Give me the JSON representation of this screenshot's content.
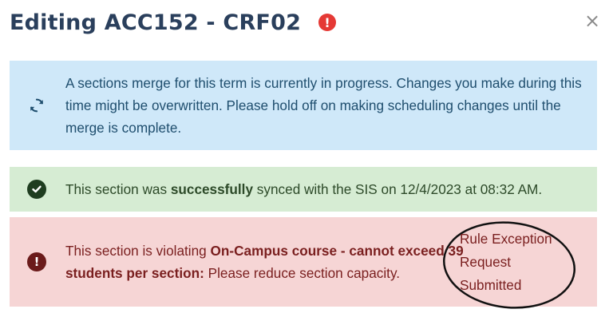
{
  "dialog": {
    "title": "Editing ACC152 - CRF02",
    "title_alert_glyph": "!",
    "close_glyph": "×"
  },
  "alerts": {
    "info": {
      "icon": "sync-icon",
      "message": "A sections merge for this term is currently in progress. Changes you make during this time might be overwritten. Please hold off on making scheduling changes until the merge is complete.",
      "color": "#cfe8f9"
    },
    "success": {
      "icon": "check-circle-icon",
      "text_before": "This section was ",
      "text_bold": "successfully",
      "text_after": " synced with the SIS on 12/4/2023 at 08:32 AM.",
      "color": "#d6ecd3"
    },
    "danger": {
      "icon": "exclamation-circle-icon",
      "text_before": "This section is violating ",
      "rule_bold": "On-Campus course - cannot exceed 39 students per section:",
      "text_after": " Please reduce section capacity.",
      "color": "#f6d5d5"
    }
  },
  "annotation": {
    "lines": [
      "Rule Exception",
      "Request",
      "Submitted"
    ]
  },
  "colors": {
    "title": "#2a3f5c",
    "alert_red": "#e53935"
  }
}
